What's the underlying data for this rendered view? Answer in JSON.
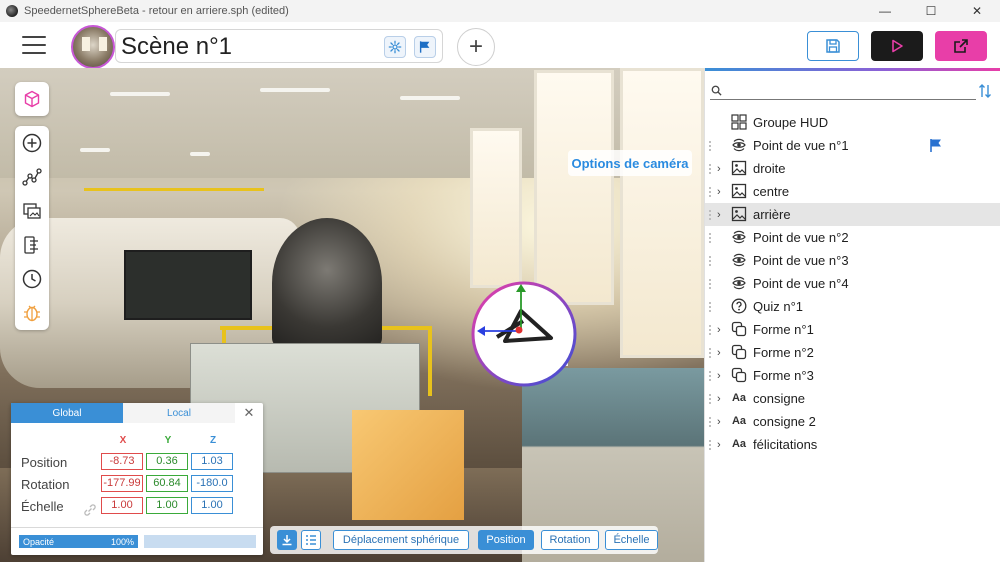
{
  "window": {
    "title": "SpeedernetSphereBeta - retour en arriere.sph (edited)",
    "minimize": "—",
    "maximize": "☐",
    "close": "✕"
  },
  "header": {
    "scene_title": "Scène n°1",
    "add_symbol": "+"
  },
  "viewport": {
    "camera_options": "Options de caméra"
  },
  "transform": {
    "tabs": {
      "global": "Global",
      "local": "Local"
    },
    "close_symbol": "✕",
    "axes": {
      "x": "X",
      "y": "Y",
      "z": "Z"
    },
    "rows": {
      "position": {
        "label": "Position",
        "x": "-8.73",
        "y": "0.36",
        "z": "1.03"
      },
      "rotation": {
        "label": "Rotation",
        "x": "-177.99",
        "y": "60.84",
        "z": "-180.0"
      },
      "scale": {
        "label": "Échelle",
        "x": "1.00",
        "y": "1.00",
        "z": "1.00"
      }
    },
    "opacity": {
      "label": "Opacité",
      "value": "100%",
      "fraction": 0.5
    }
  },
  "bottom_toolbar": {
    "spherical": "Déplacement sphérique",
    "position": "Position",
    "rotation": "Rotation",
    "scale": "Échelle"
  },
  "tree": {
    "search": {
      "value": "",
      "placeholder": ""
    },
    "items": [
      {
        "label": "Groupe HUD",
        "icon": "grid-icon",
        "chevron": false,
        "drag": false
      },
      {
        "label": "Point de vue n°1",
        "icon": "viewpoint-icon",
        "chevron": false,
        "drag": true,
        "flag": true
      },
      {
        "label": "droite",
        "icon": "image-icon",
        "chevron": true,
        "drag": true
      },
      {
        "label": "centre",
        "icon": "image-icon",
        "chevron": true,
        "drag": true
      },
      {
        "label": "arrière",
        "icon": "image-icon",
        "chevron": true,
        "drag": true,
        "selected": true
      },
      {
        "label": "Point de vue n°2",
        "icon": "viewpoint-icon",
        "chevron": false,
        "drag": true
      },
      {
        "label": "Point de vue n°3",
        "icon": "viewpoint-icon",
        "chevron": false,
        "drag": true
      },
      {
        "label": "Point de vue n°4",
        "icon": "viewpoint-icon",
        "chevron": false,
        "drag": true
      },
      {
        "label": "Quiz n°1",
        "icon": "quiz-icon",
        "chevron": false,
        "drag": true
      },
      {
        "label": "Forme n°1",
        "icon": "shape-icon",
        "chevron": true,
        "drag": true
      },
      {
        "label": "Forme n°2",
        "icon": "shape-icon",
        "chevron": true,
        "drag": true
      },
      {
        "label": "Forme n°3",
        "icon": "shape-icon",
        "chevron": true,
        "drag": true
      },
      {
        "label": "consigne",
        "icon": "text-icon",
        "chevron": true,
        "drag": true
      },
      {
        "label": "consigne 2",
        "icon": "text-icon",
        "chevron": true,
        "drag": true
      },
      {
        "label": "félicitations",
        "icon": "text-icon",
        "chevron": true,
        "drag": true
      }
    ],
    "chevron_symbol": "›",
    "text_icon_glyph": "Aa"
  },
  "colors": {
    "accent": "#3a8fd6",
    "brand_pink": "#e83ea8",
    "axis_x": "#e04b4b",
    "axis_y": "#3aaa3a",
    "axis_z": "#3a8fd6"
  }
}
